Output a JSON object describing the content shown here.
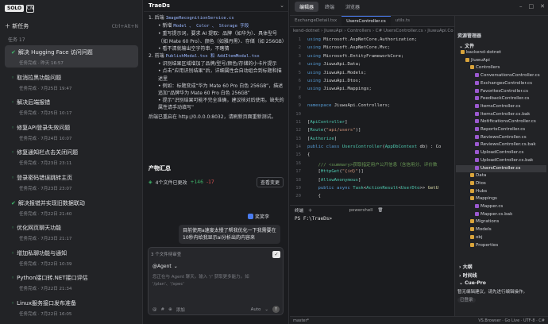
{
  "app": {
    "logo": "SOLO",
    "logo2": "CN"
  },
  "sidebar": {
    "new_task": "新任务",
    "shortcut": "Ctrl+Alt+N",
    "tasks_label": "任务 17",
    "tasks": [
      {
        "title": "解决 Hugging Face 访问问题",
        "meta": "任务完成 · 昨天 16:57",
        "done": true,
        "selected": true
      },
      {
        "title": "取消拉黑功能问题",
        "meta": "任务完成 · 7月25日 19:47",
        "done": false
      },
      {
        "title": "解决后端报错",
        "meta": "任务完成 · 7月25日 10:17",
        "done": false
      },
      {
        "title": "修复API登录失效问题",
        "meta": "任务完成 · 7月24日 10:07",
        "done": false
      },
      {
        "title": "修复通知栏点击关闭问题",
        "meta": "任务完成 · 7月23日 23:11",
        "done": false
      },
      {
        "title": "登录密码错误跳转主页",
        "meta": "任务完成 · 7月23日 23:07",
        "done": false
      },
      {
        "title": "解决报错并实现旧数据联动",
        "meta": "任务完成 · 7月22日 21:40",
        "done": true
      },
      {
        "title": "优化网页聊天功能",
        "meta": "任务完成 · 7月23日 21:17",
        "done": false
      },
      {
        "title": "增加私聊功能与通知",
        "meta": "任务完成 · 7月22日 10:39",
        "done": false
      },
      {
        "title": "Python接口转.NET接口评估",
        "meta": "任务完成 · 7月22日 21:34",
        "done": false
      },
      {
        "title": "Linux服务接口发布准备",
        "meta": "任务完成 · 7月22日 16:05",
        "done": false
      }
    ]
  },
  "chat": {
    "title": "TraeDs",
    "step1": "1. 后端",
    "step1_code": "ImageRecognitionService.cs",
    "b1": "新增",
    "b1_code": "Model 、 Color 、 Storage 字段",
    "b2": "重写提示词，要求 AI 提取：品牌（如华为）、具体型号（如 Mate 60 Pro）、颜色（如雅丹黑）、存储（如 256GB）",
    "b3": "看不清就输出空字符串，不瞎猜",
    "step2": "2. 前端",
    "step2_code": "PublishModal.tsx 和 AddItemModal.tsx",
    "c1": "识别结果区域增加了品牌/型号/颜色/存储的小卡片提示",
    "c2": "点击“应用识别结果”后，详细属性会自动组合到标题和描述里",
    "c3": "例如：标题变成“华为 Mate 60 Pro 白色 256GB”，描述追加“品牌华为 Mate 60 Pro 白色 256GB”",
    "c4": "提示“识别结果可能不完全准确，建议核对后使用。缺失的属性请手动填写”",
    "restart": "后端已重启在 http://0.0.0.0:8032，请刷新页面重新测试。",
    "changes_title": "产物汇总",
    "files_changed": "4个文件已更改",
    "plus": "+146",
    "minus": "-17",
    "review": "查看变更",
    "user": "笑笑李",
    "bubble": "目前使用a速度太慢了帮我优化一下我需要在10秒内给我显示ai分析出的内容来",
    "input_files": "3 个文件待审查",
    "agent": "@Agent",
    "placeholder": "您正在与 Agent 聊天。输入 '/' 获取更多能力。如 '/plan'、'/spec'",
    "foot_add": "添加",
    "foot_auto": "Auto"
  },
  "editor": {
    "tabs": [
      "编辑器",
      "终端",
      "浏览器"
    ],
    "file_tabs": [
      "ExchangeDetail.tsx",
      "UsersController.cs",
      "utils.ts"
    ],
    "breadcrumb": "kend-dotnet › JiuwuApi › Controllers › C# UsersController.cs › JiuwuApi.Co",
    "lines": [
      {
        "n": "1",
        "segs": [
          [
            "kw",
            "using "
          ],
          [
            "pl",
            "Microsoft.AspNetCore.Authorization;"
          ]
        ]
      },
      {
        "n": "2",
        "segs": [
          [
            "kw",
            "using "
          ],
          [
            "pl",
            "Microsoft.AspNetCore.Mvc;"
          ]
        ]
      },
      {
        "n": "3",
        "segs": [
          [
            "kw",
            "using "
          ],
          [
            "pl",
            "Microsoft.EntityFrameworkCore;"
          ]
        ]
      },
      {
        "n": "4",
        "segs": [
          [
            "kw",
            "using "
          ],
          [
            "pl",
            "JiuwuApi.Data;"
          ]
        ]
      },
      {
        "n": "5",
        "segs": [
          [
            "kw",
            "using "
          ],
          [
            "pl",
            "JiuwuApi.Models;"
          ]
        ]
      },
      {
        "n": "6",
        "segs": [
          [
            "kw",
            "using "
          ],
          [
            "pl",
            "JiuwuApi.Dtos;"
          ]
        ]
      },
      {
        "n": "7",
        "segs": [
          [
            "kw",
            "using "
          ],
          [
            "pl",
            "JiuwuApi.Mappings;"
          ]
        ]
      },
      {
        "n": "8",
        "segs": []
      },
      {
        "n": "9",
        "segs": [
          [
            "kw",
            "namespace "
          ],
          [
            "pl",
            "JiuwuApi.Controllers;"
          ]
        ]
      },
      {
        "n": "10",
        "segs": []
      },
      {
        "n": "11",
        "segs": [
          [
            "pl",
            "["
          ],
          [
            "ty",
            "ApiController"
          ],
          [
            "pl",
            "]"
          ]
        ]
      },
      {
        "n": "12",
        "segs": [
          [
            "pl",
            "["
          ],
          [
            "ty",
            "Route"
          ],
          [
            "pl",
            "("
          ],
          [
            "st",
            "\"api/users\""
          ],
          [
            "pl",
            ")]"
          ]
        ]
      },
      {
        "n": "13",
        "segs": [
          [
            "pl",
            "["
          ],
          [
            "ty",
            "Authorize"
          ],
          [
            "pl",
            "]"
          ]
        ]
      },
      {
        "n": "14",
        "segs": [
          [
            "kw",
            "public class "
          ],
          [
            "ty",
            "UsersController"
          ],
          [
            "pl",
            "("
          ],
          [
            "ty",
            "AppDbContext"
          ],
          [
            "pl",
            " db) : Co"
          ]
        ]
      },
      {
        "n": "15",
        "segs": [
          [
            "pl",
            "{"
          ]
        ]
      },
      {
        "n": "16",
        "segs": [
          [
            "cm",
            "    /// <summary>获取指定用户公开信息（含信用分、评价数"
          ]
        ]
      },
      {
        "n": "17",
        "segs": [
          [
            "pl",
            "    ["
          ],
          [
            "ty",
            "HttpGet"
          ],
          [
            "pl",
            "("
          ],
          [
            "st",
            "\"{id}\""
          ],
          [
            "pl",
            ")]"
          ]
        ]
      },
      {
        "n": "18",
        "segs": [
          [
            "pl",
            "    ["
          ],
          [
            "ty",
            "AllowAnonymous"
          ],
          [
            "pl",
            "]"
          ]
        ]
      },
      {
        "n": "19",
        "segs": [
          [
            "kw",
            "    public async "
          ],
          [
            "ty",
            "Task"
          ],
          [
            "pl",
            "<"
          ],
          [
            "ty",
            "ActionResult"
          ],
          [
            "pl",
            "<"
          ],
          [
            "ty",
            "UserDto"
          ],
          [
            "pl",
            ">> "
          ],
          [
            "mt",
            "GetU"
          ]
        ]
      },
      {
        "n": "20",
        "segs": [
          [
            "pl",
            "    {"
          ]
        ]
      }
    ],
    "terminal_label": "终端",
    "terminal_tab": "powershell",
    "terminal_prompt": "PS F:\\TraeDs>"
  },
  "explorer": {
    "title": "资源管理器",
    "section": "文件",
    "items": [
      {
        "name": "backend-dotnet",
        "type": "fo",
        "indent": 1
      },
      {
        "name": "JiuwuApi",
        "type": "fo",
        "indent": 2
      },
      {
        "name": "Controllers",
        "type": "fo",
        "indent": 3
      },
      {
        "name": "ConversationsController.cs",
        "type": "cs",
        "indent": 4
      },
      {
        "name": "ExchangesController.cs",
        "type": "cs",
        "indent": 4
      },
      {
        "name": "FavoritesController.cs",
        "type": "cs",
        "indent": 4
      },
      {
        "name": "FeedbackController.cs",
        "type": "cs",
        "indent": 4
      },
      {
        "name": "ItemsController.cs",
        "type": "cs",
        "indent": 4
      },
      {
        "name": "ItemsController.cs.bak",
        "type": "cs",
        "indent": 4
      },
      {
        "name": "NotificationsController.cs",
        "type": "cs",
        "indent": 4
      },
      {
        "name": "ReportsController.cs",
        "type": "cs",
        "indent": 4
      },
      {
        "name": "ReviewsController.cs",
        "type": "cs",
        "indent": 4
      },
      {
        "name": "ReviewsController.cs.bak",
        "type": "cs",
        "indent": 4
      },
      {
        "name": "UploadController.cs",
        "type": "cs",
        "indent": 4
      },
      {
        "name": "UploadController.cs.bak",
        "type": "cs",
        "indent": 4
      },
      {
        "name": "UsersController.cs",
        "type": "cs",
        "indent": 4,
        "sel": true
      },
      {
        "name": "Data",
        "type": "fo",
        "indent": 3
      },
      {
        "name": "Dtos",
        "type": "fo",
        "indent": 3
      },
      {
        "name": "Hubs",
        "type": "fo",
        "indent": 3
      },
      {
        "name": "Mappings",
        "type": "fo",
        "indent": 3
      },
      {
        "name": "Mapper.cs",
        "type": "cs",
        "indent": 4
      },
      {
        "name": "Mapper.cs.bak",
        "type": "cs",
        "indent": 4
      },
      {
        "name": "Migrations",
        "type": "fo",
        "indent": 3
      },
      {
        "name": "Models",
        "type": "fo",
        "indent": 3
      },
      {
        "name": "obj",
        "type": "fo",
        "indent": 3
      },
      {
        "name": "Properties",
        "type": "fo",
        "indent": 3
      }
    ],
    "outline": "大纲",
    "timeline": "时间线",
    "cue": "Cue-Pro",
    "cue_text": "暂无编辑建议，请先进行编辑操作。",
    "cue_btn": "已登录"
  },
  "status": {
    "left": "master*",
    "right": "VS.Browser · Go Live · UTF-8 · C#"
  }
}
